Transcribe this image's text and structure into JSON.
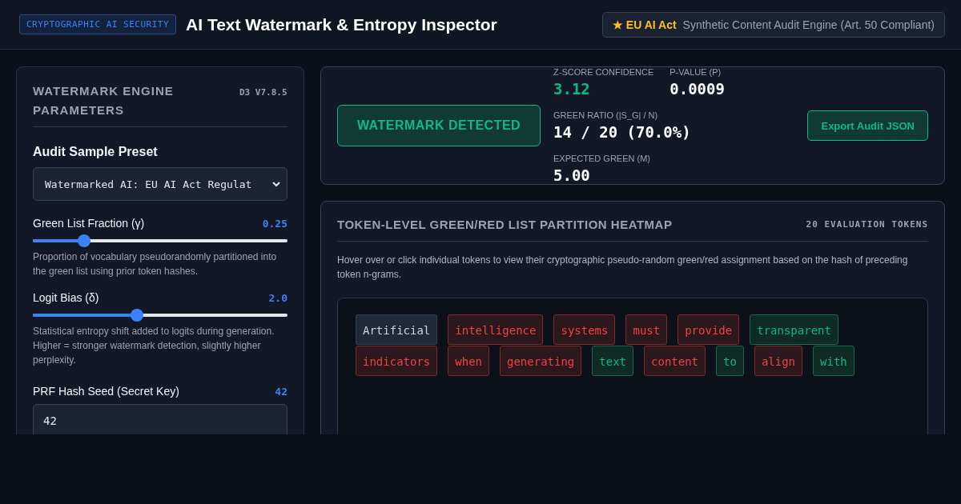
{
  "header": {
    "badge": "CRYPTOGRAPHIC AI SECURITY",
    "title": "AI Text Watermark & Entropy Inspector",
    "compliance": {
      "star": "★",
      "tag": "EU AI Act",
      "text": "Synthetic Content Audit Engine (Art. 50 Compliant)"
    }
  },
  "sidebar": {
    "title": "WATERMARK ENGINE PARAMETERS",
    "version": "D3 V7.8.5",
    "preset": {
      "label": "Audit Sample Preset",
      "value": "Watermarked AI: EU AI Act Regulat"
    },
    "sliders": [
      {
        "label": "Green List Fraction (γ)",
        "reading": "0.25",
        "level": 0.2,
        "hint": "Proportion of vocabulary pseudorandomly partitioned into the green list using prior token hashes."
      },
      {
        "label": "Logit Bias (δ)",
        "reading": "2.0",
        "level": 0.41,
        "hint": "Statistical entropy shift added to logits during generation. Higher = stronger watermark detection, slightly higher perplexity."
      }
    ],
    "seed": {
      "label": "PRF Hash Seed (Secret Key)",
      "reading": "42",
      "value": "42"
    }
  },
  "result": {
    "verdict": "WATERMARK DETECTED",
    "detected": true,
    "stats": [
      {
        "label": "Z-SCORE CONFIDENCE",
        "value": "3.12",
        "kind": "accent"
      },
      {
        "label": "P-VALUE (P)",
        "value": "0.0009",
        "kind": "plain"
      },
      {
        "label": "GREEN RATIO (|S_G| / N)",
        "value": "14 / 20 (70.0%)",
        "kind": "wide"
      },
      {
        "label": "EXPECTED GREEN (M)",
        "value": "5.00",
        "kind": "wide"
      }
    ],
    "export_button": "Export Audit JSON"
  },
  "heatmap": {
    "title": "TOKEN-LEVEL GREEN/RED LIST PARTITION HEATMAP",
    "count": "20 EVALUATION TOKENS",
    "description": "Hover over or click individual tokens to view their cryptographic pseudo-random green/red assignment based on the hash of preceding token n-grams.",
    "tokens": [
      {
        "text": "Artificial",
        "kind": "neutral"
      },
      {
        "text": "intelligence",
        "kind": "red"
      },
      {
        "text": "systems",
        "kind": "red"
      },
      {
        "text": "must",
        "kind": "red"
      },
      {
        "text": "provide",
        "kind": "red"
      },
      {
        "text": "transparent",
        "kind": "green"
      },
      {
        "text": "indicators",
        "kind": "red"
      },
      {
        "text": "when",
        "kind": "red"
      },
      {
        "text": "generating",
        "kind": "red"
      },
      {
        "text": "text",
        "kind": "green"
      },
      {
        "text": "content",
        "kind": "red"
      },
      {
        "text": "to",
        "kind": "green"
      },
      {
        "text": "align",
        "kind": "red"
      },
      {
        "text": "with",
        "kind": "green"
      }
    ]
  }
}
